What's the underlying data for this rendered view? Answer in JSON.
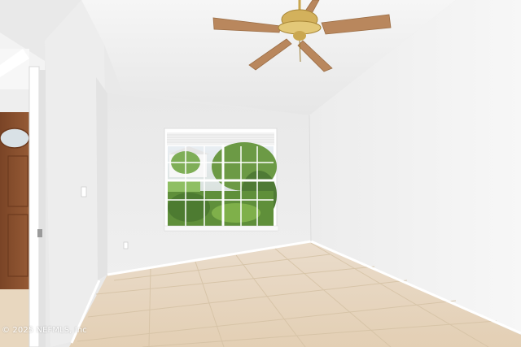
{
  "photo": {
    "subject": "empty room with window, ceiling fan and tile floor",
    "watermark": "2025 NEFMLS, Inc"
  },
  "colors": {
    "ceiling": "#f2f2f2",
    "back_wall": "#ededed",
    "right_wall": "#f4f4f4",
    "left_wall": "#f0f0f0",
    "floor_tile": "#e8d7bf",
    "door_wood": "#8a4f2e",
    "fan_blade": "#b9875d",
    "fan_brass": "#caa74f",
    "foliage": "#5f8f3a"
  }
}
